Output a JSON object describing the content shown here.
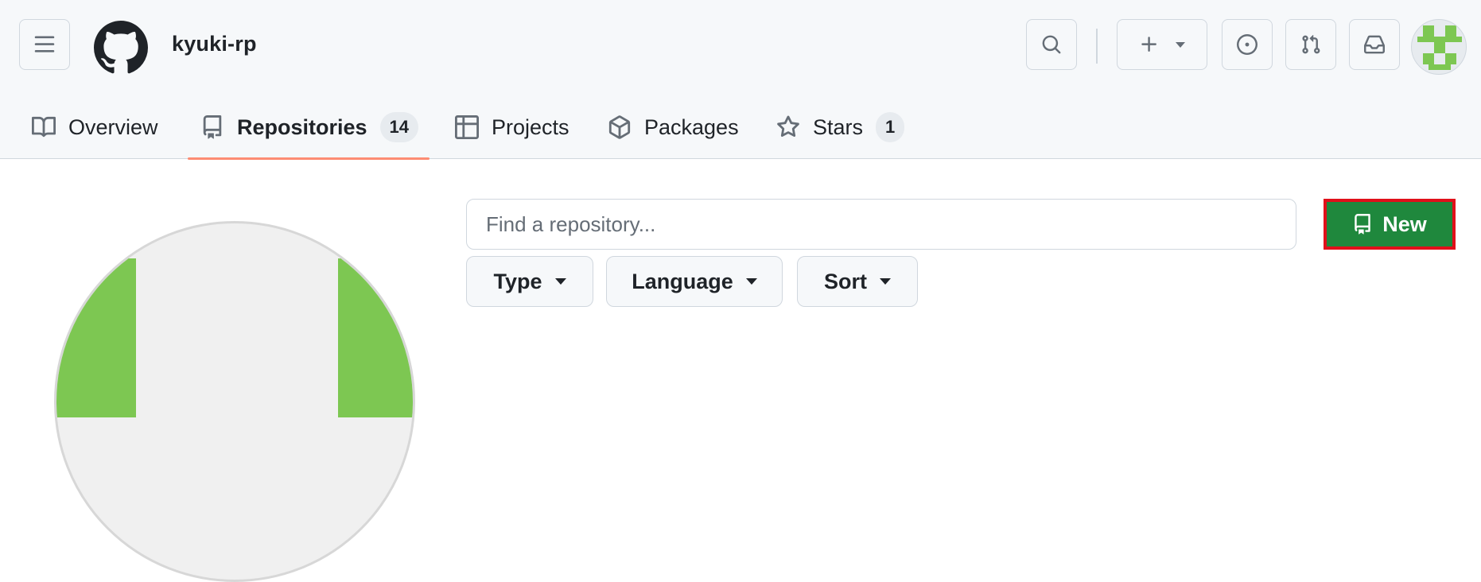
{
  "header": {
    "username": "kyuki-rp",
    "icons": [
      "hamburger-icon",
      "github-logo-icon",
      "search-icon",
      "plus-icon",
      "chevron-down-icon",
      "issue-icon",
      "pull-request-icon",
      "inbox-icon"
    ]
  },
  "tabs": [
    {
      "label": "Overview",
      "icon": "book-icon"
    },
    {
      "label": "Repositories",
      "icon": "repo-icon",
      "count": "14",
      "active": true
    },
    {
      "label": "Projects",
      "icon": "table-icon"
    },
    {
      "label": "Packages",
      "icon": "package-icon"
    },
    {
      "label": "Stars",
      "icon": "star-icon",
      "count": "1"
    }
  ],
  "repo": {
    "search_placeholder": "Find a repository...",
    "new_label": "New",
    "filters": [
      "Type",
      "Language",
      "Sort"
    ]
  },
  "colors": {
    "accent_underline": "#fd8c73",
    "new_button": "#1f883d",
    "highlight_border": "#e0101a",
    "avatar_green": "#7dc752"
  }
}
